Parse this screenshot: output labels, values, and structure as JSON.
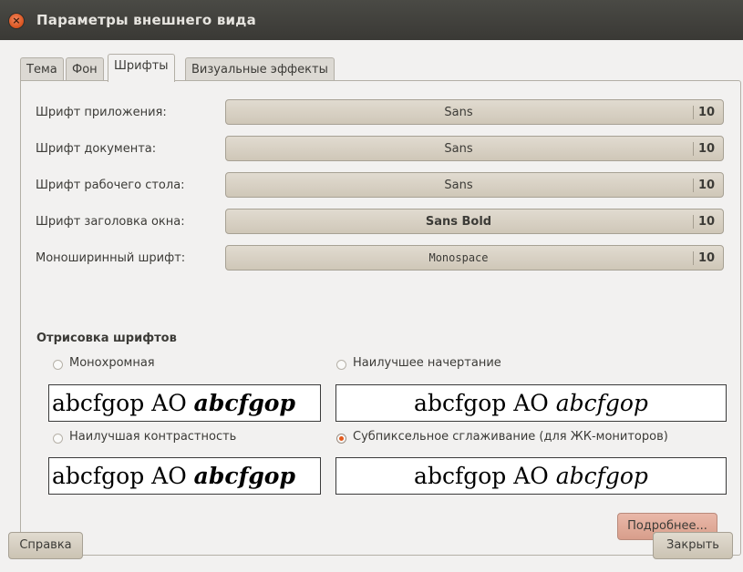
{
  "window": {
    "title": "Параметры внешнего вида"
  },
  "tabs": [
    {
      "label": "Тема",
      "active": false
    },
    {
      "label": "Фон",
      "active": false
    },
    {
      "label": "Шрифты",
      "active": true
    },
    {
      "label": "Визуальные эффекты",
      "active": false
    }
  ],
  "fonts": [
    {
      "label": "Шрифт приложения:",
      "font": "Sans",
      "size": "10"
    },
    {
      "label": "Шрифт документа:",
      "font": "Sans",
      "size": "10"
    },
    {
      "label": "Шрифт рабочего стола:",
      "font": "Sans",
      "size": "10"
    },
    {
      "label": "Шрифт заголовка окна:",
      "font": "Sans Bold",
      "size": "10"
    },
    {
      "label": "Моноширинный шрифт:",
      "font": "Monospace",
      "size": "10"
    }
  ],
  "rendering": {
    "title": "Отрисовка шрифтов",
    "sample_regular": "abcfgop AO ",
    "sample_italic": "abcfgop",
    "options": [
      {
        "label": "Монохромная",
        "selected": false
      },
      {
        "label": "Наилучшее начертание",
        "selected": false
      },
      {
        "label": "Наилучшая контрастность",
        "selected": false
      },
      {
        "label": "Субпиксельное сглаживание (для ЖК-мониторов)",
        "selected": true
      }
    ]
  },
  "buttons": {
    "details": "Подробнее...",
    "help": "Справка",
    "close": "Закрыть"
  },
  "colors": {
    "titlebar": "#3c3b37",
    "accent": "#dd4814",
    "button": "#d6cfc2"
  }
}
